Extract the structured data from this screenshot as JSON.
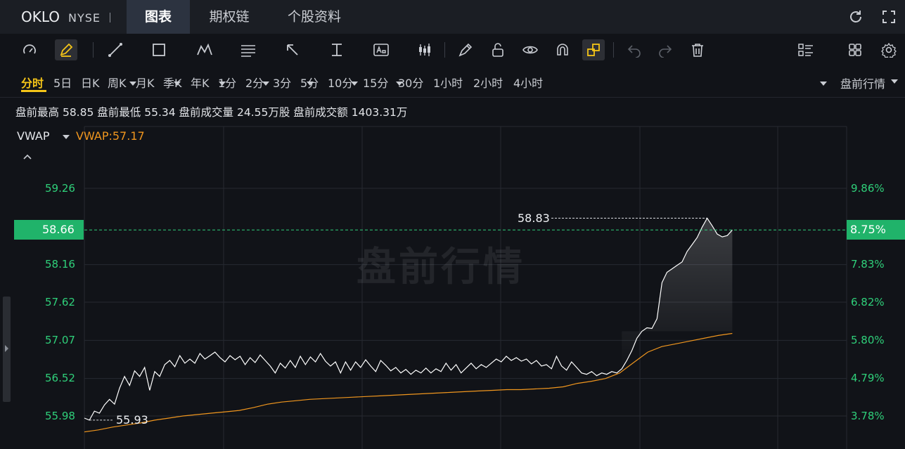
{
  "header": {
    "ticker": "OKLO",
    "exchange": "NYSE",
    "tabs": [
      {
        "label": "图表",
        "active": true
      },
      {
        "label": "期权链",
        "active": false
      },
      {
        "label": "个股资料",
        "active": false
      }
    ]
  },
  "periods": [
    "分时",
    "5日",
    "日K",
    "周K",
    "月K",
    "季K",
    "年K",
    "1分",
    "2分",
    "3分",
    "5分",
    "10分",
    "15分",
    "30分",
    "1小时",
    "2小时",
    "4小时"
  ],
  "active_period": "分时",
  "session_mode": "盘前行情",
  "stats": {
    "high_label": "盘前最高",
    "high": "58.85",
    "low_label": "盘前最低",
    "low": "55.34",
    "volume_label": "盘前成交量",
    "volume": "24.55万股",
    "turnover_label": "盘前成交额",
    "turnover": "1403.31万"
  },
  "indicator": {
    "name": "VWAP",
    "value_text": "VWAP:57.17"
  },
  "watermark": "盘前行情",
  "colors": {
    "accent": "#f5c518",
    "up": "#2fd07a",
    "price_line": "#ffffff",
    "vwap_line": "#f0961e",
    "current_badge": "#20b36a"
  },
  "chart_data": {
    "type": "line",
    "y_ticks": [
      "59.26",
      "58.66",
      "58.16",
      "57.62",
      "57.07",
      "56.52",
      "55.98"
    ],
    "y_tick_values": [
      59.26,
      58.66,
      58.16,
      57.62,
      57.07,
      56.52,
      55.98
    ],
    "pct_ticks": [
      "9.86%",
      "8.75%",
      "7.83%",
      "6.82%",
      "5.80%",
      "4.79%",
      "3.78%"
    ],
    "current_price": "58.66",
    "current_pct": "8.75%",
    "ylim": [
      55.65,
      59.82
    ],
    "max_annotation": "58.83",
    "min_annotation": "55.93",
    "grid": true,
    "series": [
      {
        "name": "",
        "color": "#ffffff",
        "values": [
          55.95,
          55.92,
          56.05,
          56.02,
          56.14,
          56.22,
          56.15,
          56.38,
          56.55,
          56.42,
          56.63,
          56.55,
          56.68,
          56.35,
          56.62,
          56.55,
          56.72,
          56.78,
          56.69,
          56.85,
          56.74,
          56.8,
          56.74,
          56.88,
          56.8,
          56.85,
          56.9,
          56.82,
          56.76,
          56.85,
          56.79,
          56.84,
          56.72,
          56.82,
          56.75,
          56.86,
          56.78,
          56.7,
          56.6,
          56.74,
          56.67,
          56.78,
          56.68,
          56.84,
          56.72,
          56.83,
          56.76,
          56.88,
          56.77,
          56.7,
          56.76,
          56.6,
          56.76,
          56.64,
          56.76,
          56.68,
          56.79,
          56.7,
          56.62,
          56.78,
          56.71,
          56.63,
          56.68,
          56.6,
          56.65,
          56.58,
          56.64,
          56.6,
          56.67,
          56.6,
          56.66,
          56.62,
          56.74,
          56.64,
          56.72,
          56.6,
          56.67,
          56.74,
          56.66,
          56.72,
          56.68,
          56.74,
          56.8,
          56.76,
          56.84,
          56.78,
          56.82,
          56.77,
          56.8,
          56.73,
          56.78,
          56.7,
          56.72,
          56.66,
          56.84,
          56.7,
          56.64,
          56.76,
          56.68,
          56.6,
          56.58,
          56.62,
          56.56,
          56.6,
          56.58,
          56.62,
          56.6,
          56.66,
          56.78,
          56.92,
          57.1,
          57.2,
          57.25,
          57.24,
          57.38,
          57.9,
          58.05,
          58.1,
          58.15,
          58.2,
          58.35,
          58.45,
          58.55,
          58.7,
          58.83,
          58.72,
          58.6,
          58.56,
          58.58,
          58.66
        ],
        "x_end_frac": 0.85
      },
      {
        "name": "VWAP",
        "color": "#f0961e",
        "values": [
          55.75,
          55.78,
          55.82,
          55.85,
          55.88,
          55.92,
          55.95,
          55.98,
          56.0,
          56.02,
          56.04,
          56.06,
          56.1,
          56.15,
          56.18,
          56.2,
          56.22,
          56.23,
          56.24,
          56.25,
          56.26,
          56.27,
          56.28,
          56.29,
          56.3,
          56.31,
          56.32,
          56.33,
          56.34,
          56.35,
          56.36,
          56.36,
          56.37,
          56.38,
          56.4,
          56.45,
          56.48,
          56.52,
          56.6,
          56.75,
          56.9,
          56.98,
          57.02,
          57.06,
          57.1,
          57.14,
          57.17
        ],
        "x_end_frac": 0.85
      }
    ]
  }
}
